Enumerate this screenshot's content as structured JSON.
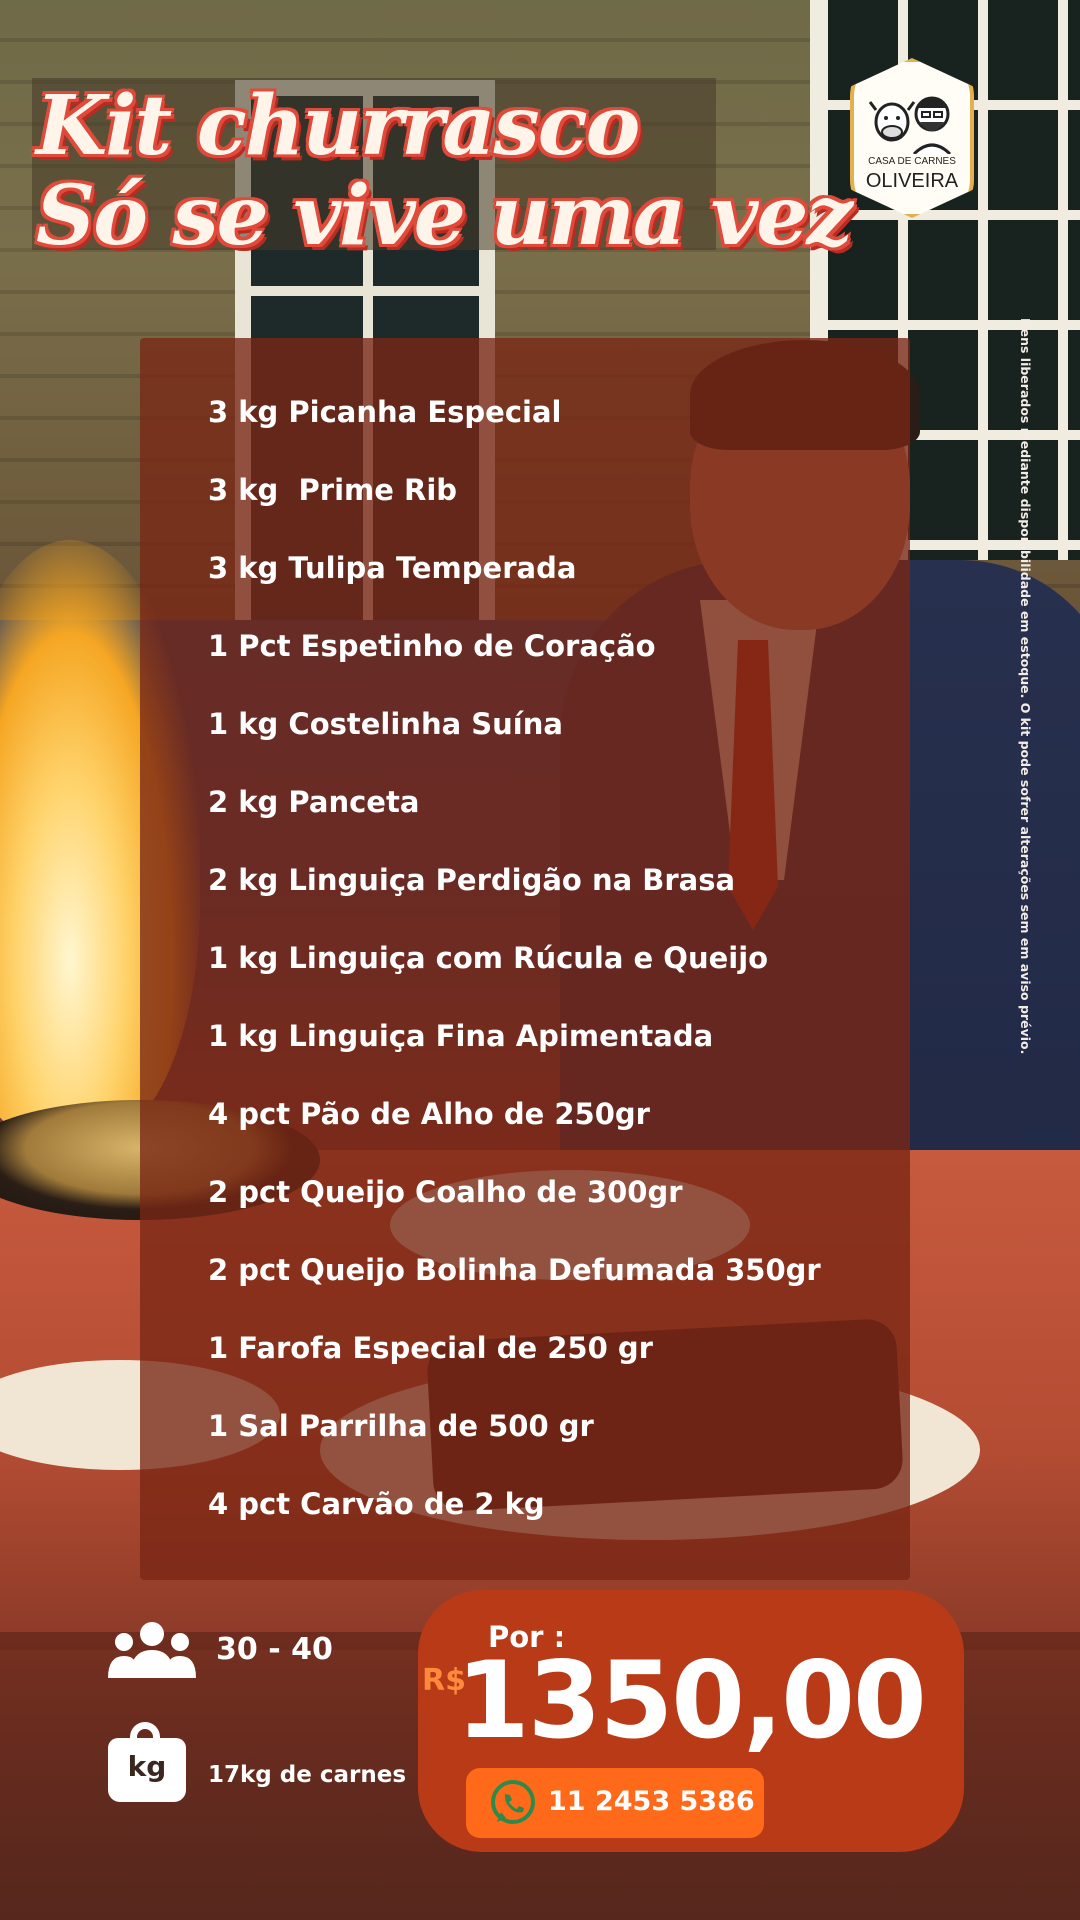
{
  "title": {
    "line1": "Kit churrasco",
    "line2": "Só se vive uma vez"
  },
  "logo": {
    "small": "CASA DE CARNES",
    "big": "OLIVEIRA"
  },
  "items": [
    "3 kg Picanha Especial",
    "3 kg  Prime Rib",
    "3 kg Tulipa Temperada",
    "1 Pct Espetinho de Coração",
    "1 kg Costelinha Suína",
    "2 kg Panceta",
    "2 kg Linguiça Perdigão na Brasa",
    "1 kg Linguiça com Rúcula e Queijo",
    "1 kg Linguiça Fina Apimentada",
    "4 pct Pão de Alho de 250gr",
    "2 pct Queijo Coalho de 300gr",
    "2 pct Queijo Bolinha Defumada 350gr",
    "1 Farofa Especial de 250 gr",
    "1 Sal Parrilha de 500 gr",
    "4 pct Carvão de 2 kg"
  ],
  "disclaimer": "Itens liberados mediante disponibilidade em estoque. O kit pode sofrer alterações sem em aviso prévio.",
  "info": {
    "people": "30 - 40",
    "kg_label": "kg",
    "weight": "17kg de carnes"
  },
  "price": {
    "prefix": "Por :",
    "currency": "R$",
    "value": "1350,00"
  },
  "contact": {
    "phone": "11 2453 5386",
    "icon": "whatsapp-icon"
  },
  "colors": {
    "title_outline": "#e04a3a",
    "panel": "#792614",
    "price_card": "#b83a17",
    "whatsapp_button": "#ff6a1a",
    "currency": "#ff8a3d"
  }
}
